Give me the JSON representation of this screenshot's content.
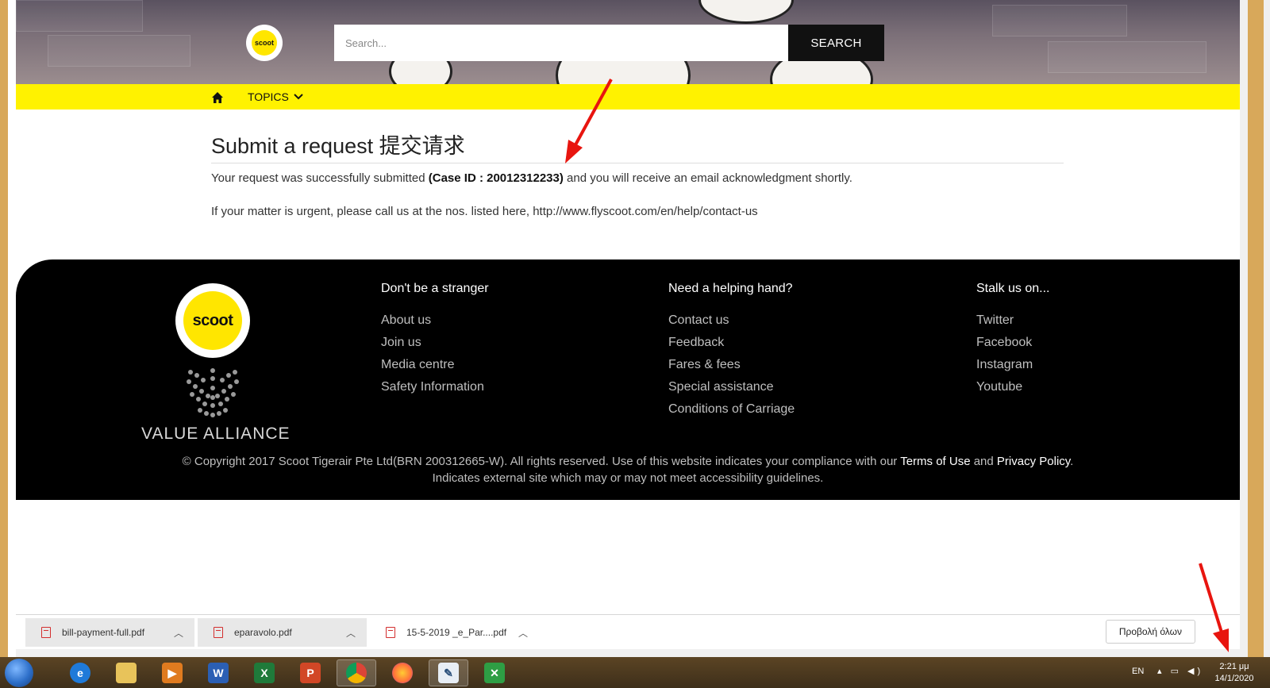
{
  "header": {
    "logo_text": "scoot",
    "search_placeholder": "Search...",
    "search_button": "SEARCH"
  },
  "nav": {
    "topics_label": "TOPICS"
  },
  "content": {
    "title": "Submit a request 提交请求",
    "message_pre": "Your request was successfully submitted ",
    "case_id": "(Case ID : 20012312233)",
    "message_post": " and you will receive an email acknowledgment shortly.",
    "urgent": "If your matter is urgent, please call us at the nos. listed here, http://www.flyscoot.com/en/help/contact-us"
  },
  "footer": {
    "logo_text": "scoot",
    "alliance_text": "VALUE ALLIANCE",
    "col1": {
      "heading": "Don't be a stranger",
      "links": [
        "About us",
        "Join us",
        "Media centre",
        "Safety Information"
      ]
    },
    "col2": {
      "heading": "Need a helping hand?",
      "links": [
        "Contact us",
        "Feedback",
        "Fares & fees",
        "Special assistance",
        "Conditions of Carriage"
      ]
    },
    "col3": {
      "heading": "Stalk us on...",
      "links": [
        "Twitter",
        "Facebook",
        "Instagram",
        "Youtube"
      ]
    },
    "copyright_pre": "© Copyright 2017 Scoot Tigerair Pte Ltd(BRN 200312665-W). All rights reserved. Use of this website indicates your compliance with our ",
    "terms": "Terms of Use",
    "and": " and ",
    "privacy": "Privacy Policy",
    "period": ".",
    "external_note": "Indicates external site which may or may not meet accessibility guidelines."
  },
  "downloads": {
    "items": [
      {
        "name": "bill-payment-full.pdf"
      },
      {
        "name": "eparavolo.pdf"
      },
      {
        "name": "15-5-2019 _e_Par....pdf"
      }
    ],
    "show_all": "Προβολή όλων"
  },
  "taskbar": {
    "lang": "EN",
    "time": "2:21 μμ",
    "date": "14/1/2020"
  },
  "colors": {
    "brand_yellow": "#fff200",
    "footer_bg": "#000000",
    "annotation_red": "#e8150f"
  }
}
